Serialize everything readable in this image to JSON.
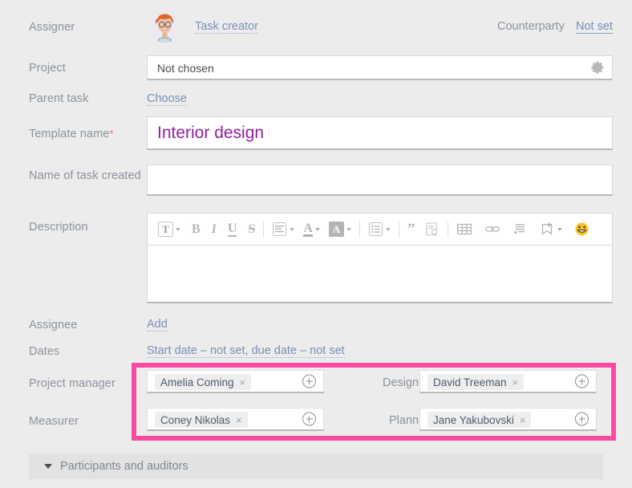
{
  "form": {
    "assigner": {
      "label": "Assigner",
      "avatar_icon": "user-avatar-illustration",
      "creator_link": "Task creator",
      "counterparty_label": "Counterparty",
      "counterparty_value": "Not set"
    },
    "project": {
      "label": "Project",
      "value": "Not chosen",
      "settings_icon": "gear-icon"
    },
    "parent_task": {
      "label": "Parent task",
      "action": "Choose"
    },
    "template_name": {
      "label": "Template name",
      "required_marker": "*",
      "value": "Interior design",
      "value_color": "#8f1ea0"
    },
    "task_created_name": {
      "label": "Name of task created",
      "value": ""
    },
    "description": {
      "label": "Description",
      "value": "",
      "toolbar": [
        {
          "name": "text-style-icon",
          "glyph": "T",
          "style": "boxed",
          "caret": true
        },
        {
          "name": "bold-icon",
          "glyph": "B",
          "style": "bold",
          "caret": false
        },
        {
          "name": "italic-icon",
          "glyph": "I",
          "style": "italic",
          "caret": false
        },
        {
          "name": "underline-icon",
          "glyph": "U",
          "style": "underline",
          "caret": false
        },
        {
          "name": "strikethrough-icon",
          "glyph": "S",
          "style": "strike",
          "caret": false
        },
        {
          "name": "separator-1",
          "glyph": "",
          "style": "sep",
          "caret": false
        },
        {
          "name": "align-icon",
          "glyph": "",
          "style": "align",
          "caret": true
        },
        {
          "name": "font-color-icon",
          "glyph": "A",
          "style": "underline-color",
          "caret": true
        },
        {
          "name": "highlight-color-icon",
          "glyph": "A",
          "style": "filled",
          "caret": true
        },
        {
          "name": "separator-2",
          "glyph": "",
          "style": "sep",
          "caret": false
        },
        {
          "name": "bullet-list-icon",
          "glyph": "",
          "style": "list",
          "caret": true
        },
        {
          "name": "separator-3",
          "glyph": "",
          "style": "sep",
          "caret": false
        },
        {
          "name": "quote-icon",
          "glyph": "”",
          "style": "quote",
          "caret": false
        },
        {
          "name": "insert-file-icon",
          "glyph": "",
          "style": "file",
          "caret": false
        },
        {
          "name": "separator-4",
          "glyph": "",
          "style": "sep",
          "caret": false
        },
        {
          "name": "table-icon",
          "glyph": "",
          "style": "table",
          "caret": false
        },
        {
          "name": "link-icon",
          "glyph": "",
          "style": "link",
          "caret": false
        },
        {
          "name": "code-icon",
          "glyph": "",
          "style": "code",
          "caret": false
        },
        {
          "name": "bookmark-add-icon",
          "glyph": "",
          "style": "bookmark",
          "caret": true
        },
        {
          "name": "emoji-icon",
          "glyph": "😀",
          "style": "emoji",
          "caret": false
        }
      ]
    },
    "assignee": {
      "label": "Assignee",
      "action": "Add"
    },
    "dates": {
      "label": "Dates",
      "value": "Start date – not set, due date – not set"
    },
    "participants": {
      "highlight_color": "#fb4ba0",
      "left": [
        {
          "label": "Project manager",
          "chip": "Amelia Coming",
          "remove_icon": "×",
          "add_icon": "plus-circle-icon"
        },
        {
          "label": "Measurer",
          "chip": "Coney Nikolas",
          "remove_icon": "×",
          "add_icon": "plus-circle-icon"
        }
      ],
      "right": [
        {
          "label": "Designer",
          "chip": "David Treeman",
          "remove_icon": "×",
          "add_icon": "plus-circle-icon"
        },
        {
          "label": "Planner",
          "chip": "Jane Yakubovski",
          "remove_icon": "×",
          "add_icon": "plus-circle-icon"
        }
      ]
    },
    "accordion": {
      "label": "Participants and auditors",
      "toggle_icon": "triangle-down-icon"
    }
  }
}
